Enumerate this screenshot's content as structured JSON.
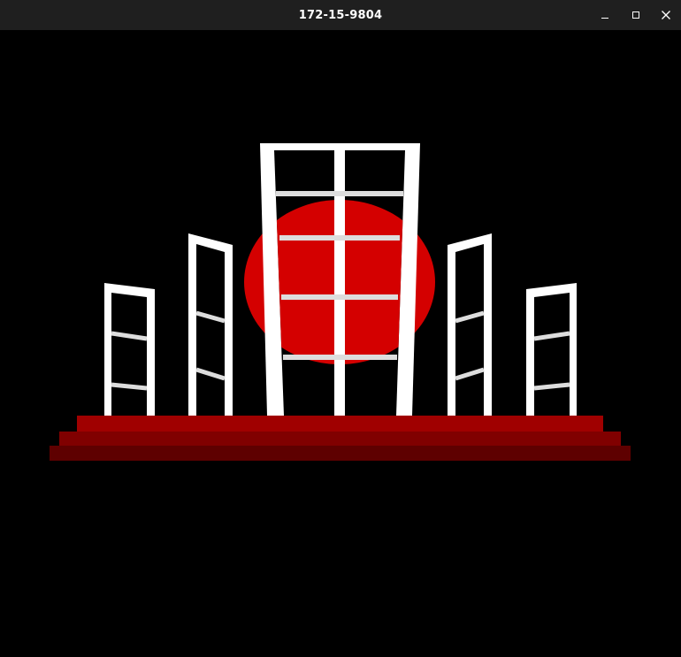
{
  "window": {
    "title": "172-15-9804"
  },
  "controls": {
    "minimize": "minimize-icon",
    "maximize": "maximize-icon",
    "close": "close-icon"
  },
  "scene": {
    "colors": {
      "background": "#000000",
      "sun": "#d40000",
      "pillar": "#ffffff",
      "pillar_rung": "#dddddd",
      "step_top": "#a00000",
      "step_middle": "#800000",
      "step_bottom": "#5e0000"
    }
  }
}
